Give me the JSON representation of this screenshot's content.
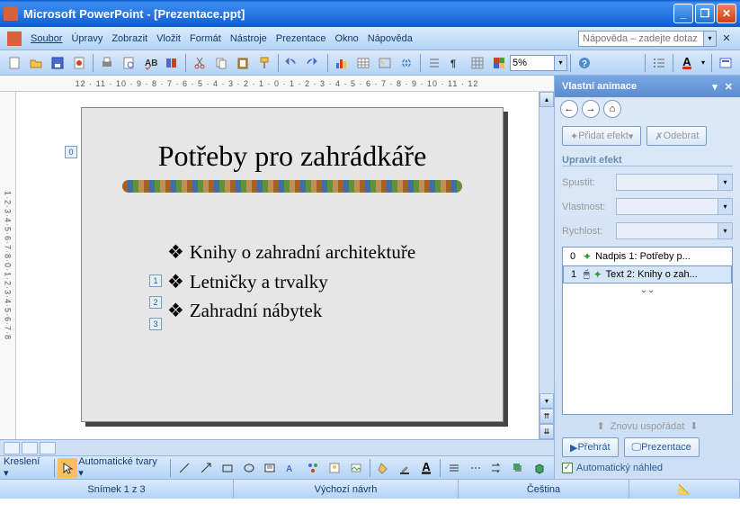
{
  "title": "Microsoft PowerPoint - [Prezentace.ppt]",
  "menus": [
    "Soubor",
    "Úpravy",
    "Zobrazit",
    "Vložit",
    "Formát",
    "Nástroje",
    "Prezentace",
    "Okno",
    "Nápověda"
  ],
  "help_placeholder": "Nápověda – zadejte dotaz",
  "zoom": "5%",
  "ruler_h": "12 · 11 · 10 · 9 · 8 · 7 · 6 · 5 · 4 · 3 · 2 · 1 · 0 · 1 · 2 · 3 · 4 · 5 · 6 · 7 · 8 · 9 · 10 · 11 · 12",
  "ruler_v": "1·2·3·4·5·6·7·8·0·1·2·3·4·5·6·7·8",
  "slide": {
    "title": "Potřeby pro zahrádkáře",
    "bullets": [
      "Knihy o zahradní architektuře",
      "Letničky a trvalky",
      "Zahradní nábytek"
    ],
    "tags": [
      "0",
      "1",
      "2",
      "3"
    ]
  },
  "pane": {
    "title": "Vlastní animace",
    "add_effect": "Přidat efekt",
    "remove": "Odebrat",
    "section": "Upravit efekt",
    "start": "Spustit:",
    "property": "Vlastnost:",
    "speed": "Rychlost:",
    "list": [
      {
        "num": "0",
        "label": "Nadpis 1: Potřeby p..."
      },
      {
        "num": "1",
        "label": "Text 2: Knihy o zah..."
      }
    ],
    "reorder": "Znovu uspořádat",
    "play": "Přehrát",
    "slideshow": "Prezentace",
    "autoprev": "Automatický náhled"
  },
  "draw": {
    "label": "Kreslení",
    "autoshapes": "Automatické tvary"
  },
  "status": {
    "slide": "Snímek 1 z 3",
    "layout": "Výchozí návrh",
    "lang": "Čeština"
  }
}
